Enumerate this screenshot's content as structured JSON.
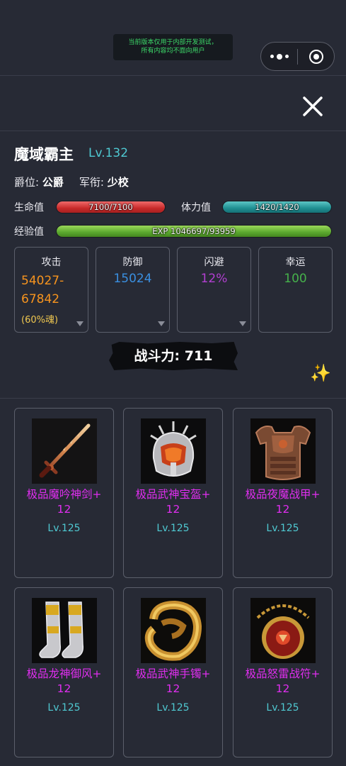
{
  "notice": {
    "line1": "当前版本仅用于内部开发测试，",
    "line2": "所有内容均不面向用户"
  },
  "capsule": {
    "more_icon": "more-dots-icon",
    "close_icon": "target-circle-icon"
  },
  "close_icon": "close-x-icon",
  "character": {
    "name": "魔域霸主",
    "level": "Lv.132",
    "title_label": "爵位:",
    "title_value": "公爵",
    "rank_label": "军衔:",
    "rank_value": "少校",
    "hp_label": "生命值",
    "hp_text": "7100/7100",
    "hp_fraction": 1.0,
    "stamina_label": "体力值",
    "stamina_text": "1420/1420",
    "stamina_fraction": 1.0,
    "exp_label": "经验值",
    "exp_text": "EXP 1046697/93959",
    "exp_fraction": 1.0
  },
  "stats": {
    "attack": {
      "label": "攻击",
      "value_line1": "54027-",
      "value_line2": "67842",
      "sub": "(60%魂)",
      "color": "#f7941e"
    },
    "defense": {
      "label": "防御",
      "value": "15024",
      "color": "#3a8fe0"
    },
    "dodge": {
      "label": "闪避",
      "value": "12%",
      "color": "#b23fd1"
    },
    "luck": {
      "label": "幸运",
      "value": "100",
      "color": "#46b14b"
    }
  },
  "power": {
    "label": "战斗力:",
    "value": "711"
  },
  "sparkle_icon": "sparkles-icon",
  "equipment": [
    {
      "name_line1": "极品魔吟神剑+",
      "name_line2": "12",
      "level": "Lv.125",
      "icon": "sword-icon"
    },
    {
      "name_line1": "极品武神宝盔+",
      "name_line2": "12",
      "level": "Lv.125",
      "icon": "helmet-icon"
    },
    {
      "name_line1": "极品夜魔战甲+",
      "name_line2": "12",
      "level": "Lv.125",
      "icon": "armor-icon"
    },
    {
      "name_line1": "极品龙神御风+",
      "name_line2": "12",
      "level": "Lv.125",
      "icon": "boots-icon"
    },
    {
      "name_line1": "极品武神手镯+",
      "name_line2": "12",
      "level": "Lv.125",
      "icon": "bracelet-icon"
    },
    {
      "name_line1": "极品怒雷战符+",
      "name_line2": "12",
      "level": "Lv.125",
      "icon": "amulet-icon"
    }
  ],
  "colors": {
    "name_purple": "#e02ef0",
    "level_cyan": "#4fc9d2",
    "background": "#272a35"
  }
}
